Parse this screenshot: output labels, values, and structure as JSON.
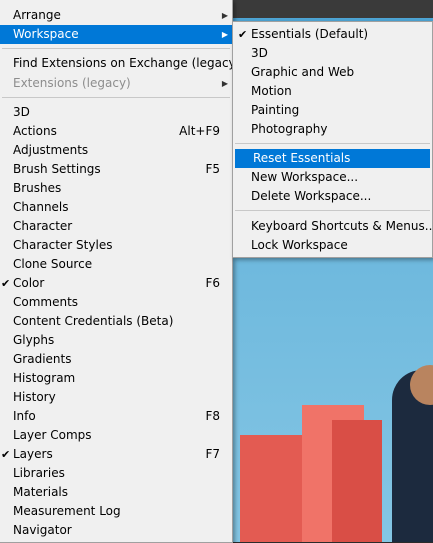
{
  "main_menu": {
    "items": [
      {
        "label": "Arrange",
        "arrow": "▶"
      },
      {
        "label": "Workspace",
        "arrow": "▶"
      },
      {
        "label": "Find Extensions on Exchange (legacy)..."
      },
      {
        "label": "Extensions (legacy)",
        "arrow": "▶"
      },
      {
        "label": "3D"
      },
      {
        "label": "Actions",
        "shortcut": "Alt+F9"
      },
      {
        "label": "Adjustments"
      },
      {
        "label": "Brush Settings",
        "shortcut": "F5"
      },
      {
        "label": "Brushes"
      },
      {
        "label": "Channels"
      },
      {
        "label": "Character"
      },
      {
        "label": "Character Styles"
      },
      {
        "label": "Clone Source"
      },
      {
        "label": "Color",
        "shortcut": "F6",
        "check": "✔"
      },
      {
        "label": "Comments"
      },
      {
        "label": "Content Credentials (Beta)"
      },
      {
        "label": "Glyphs"
      },
      {
        "label": "Gradients"
      },
      {
        "label": "Histogram"
      },
      {
        "label": "History"
      },
      {
        "label": "Info",
        "shortcut": "F8"
      },
      {
        "label": "Layer Comps"
      },
      {
        "label": "Layers",
        "shortcut": "F7",
        "check": "✔"
      },
      {
        "label": "Libraries"
      },
      {
        "label": "Materials"
      },
      {
        "label": "Measurement Log"
      },
      {
        "label": "Navigator"
      }
    ]
  },
  "workspace_menu": {
    "items": [
      {
        "label": "Essentials (Default)",
        "check": "✔"
      },
      {
        "label": "3D"
      },
      {
        "label": "Graphic and Web"
      },
      {
        "label": "Motion"
      },
      {
        "label": "Painting"
      },
      {
        "label": "Photography"
      },
      {
        "label": "Reset Essentials"
      },
      {
        "label": "New Workspace..."
      },
      {
        "label": "Delete Workspace..."
      },
      {
        "label": "Keyboard Shortcuts & Menus..."
      },
      {
        "label": "Lock Workspace"
      }
    ]
  },
  "colors": {
    "highlight": "#0078d7",
    "menu_bg": "#f0f0f0"
  }
}
